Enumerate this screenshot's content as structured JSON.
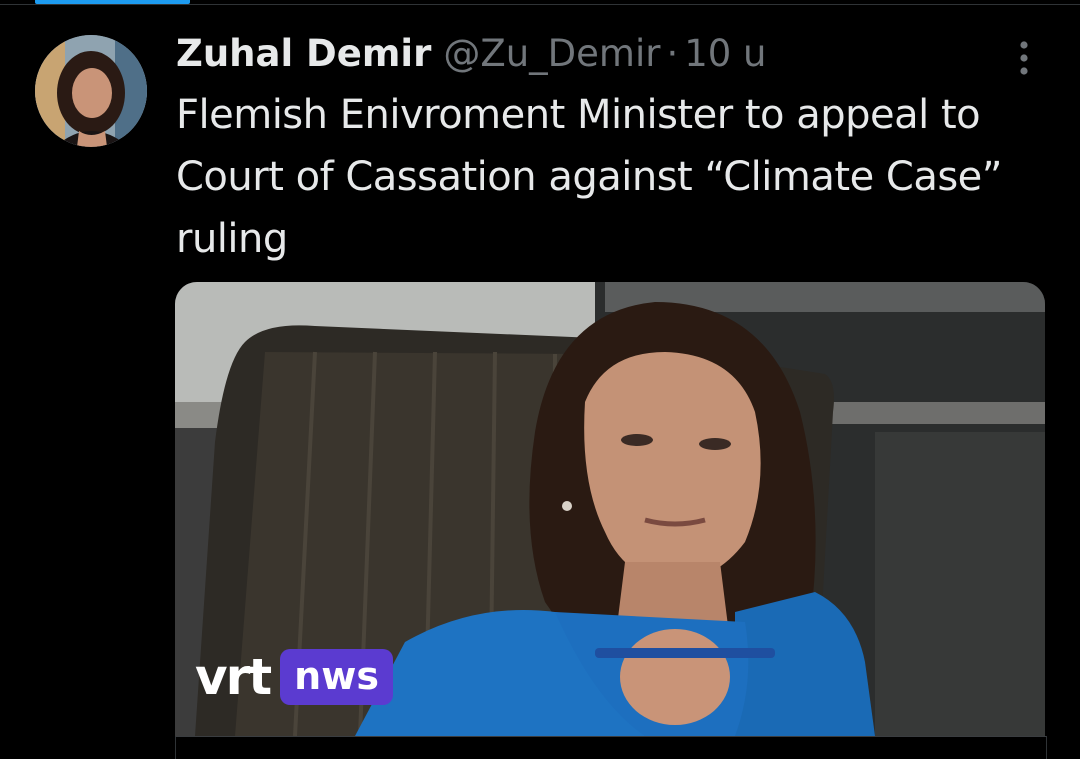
{
  "tweet": {
    "author_name": "Zuhal Demir",
    "author_handle": "@Zu_Demir",
    "separator": "·",
    "timestamp": "10 u",
    "text": "Flemish Enivroment Minister to appeal to Court of Cassation against “Climate Case” ruling",
    "more_icon": "vertical-ellipsis-icon"
  },
  "media": {
    "logo_word": "vrt",
    "logo_badge": "nws",
    "badge_color": "#5b3bd0"
  },
  "colors": {
    "background": "#000000",
    "primary_text": "#e7e9ea",
    "secondary_text": "#71767b",
    "accent": "#1d9bf0"
  }
}
